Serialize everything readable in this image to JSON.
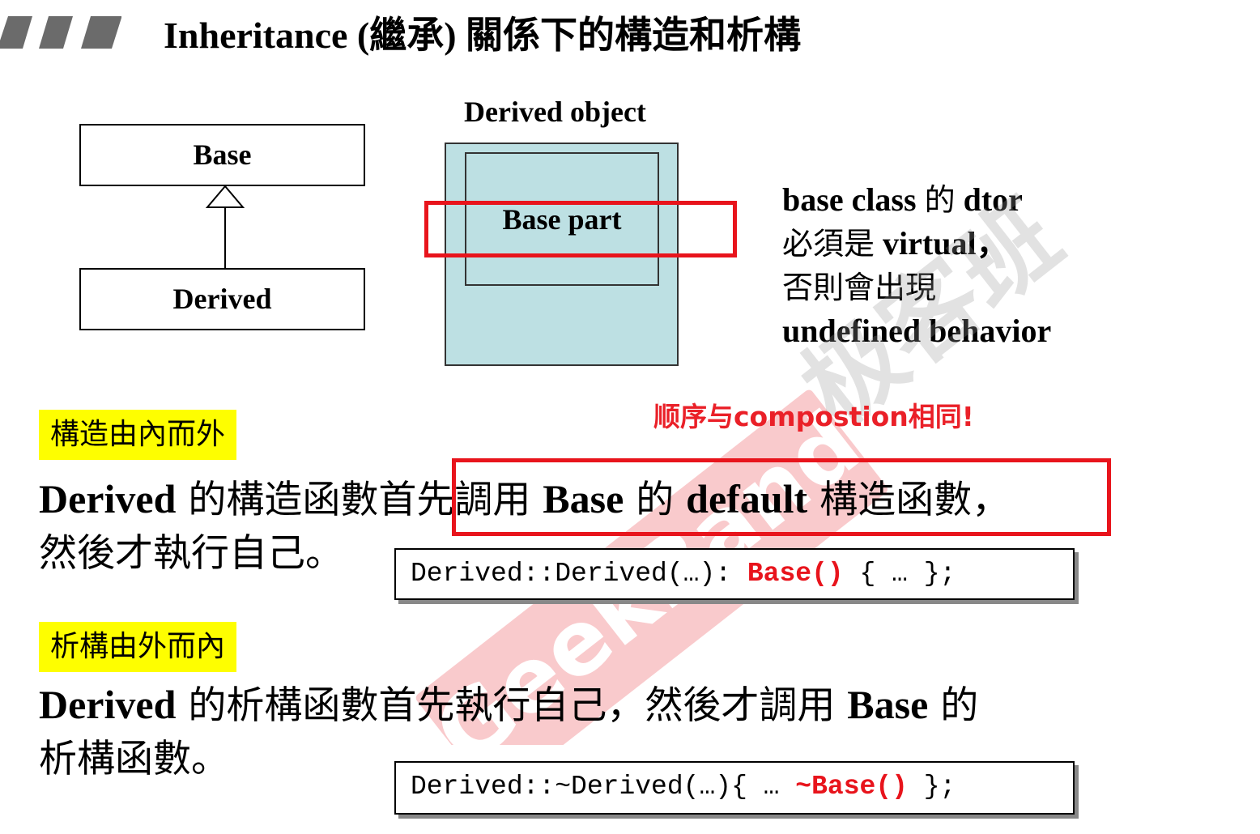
{
  "title": "Inheritance (繼承) 關係下的構造和析構",
  "uml": {
    "base": "Base",
    "derived": "Derived"
  },
  "object_diagram": {
    "label": "Derived object",
    "base_part": "Base part"
  },
  "note": {
    "line1_a": "base class ",
    "line1_b": "的",
    "line1_c": " dtor",
    "line2_a": "必須是",
    "line2_b": " virtual，",
    "line3": "否則會出現",
    "line4": "undefined behavior"
  },
  "red_note": "顺序与compostion相同!",
  "ctor": {
    "tag": "構造由內而外",
    "p1": "Derived",
    "p2": " 的構造函數首先調用 ",
    "p3": "Base",
    "p4": " 的 ",
    "p5": "default",
    "p6": " 構造函數，",
    "line2": "然後才執行自己。",
    "code_prefix": "Derived::Derived(…): ",
    "code_red": "Base()",
    "code_suffix": " { … };"
  },
  "dtor": {
    "tag": "析構由外而內",
    "p1": "Derived",
    "p2": " 的析構函數首先執行自己，然後才調用 ",
    "p3": "Base",
    "p4": " 的",
    "line2": "析構函數。",
    "code_prefix": "Derived::~Derived(…){ … ",
    "code_red": "~Base()",
    "code_suffix": " };"
  },
  "watermark": {
    "brand": "GeekBand",
    "cjk": "极客班"
  },
  "colors": {
    "accent_red": "#e8141c",
    "highlight_yellow": "#fefe00",
    "object_fill": "#bde0e3",
    "watermark": "#e8141c"
  }
}
